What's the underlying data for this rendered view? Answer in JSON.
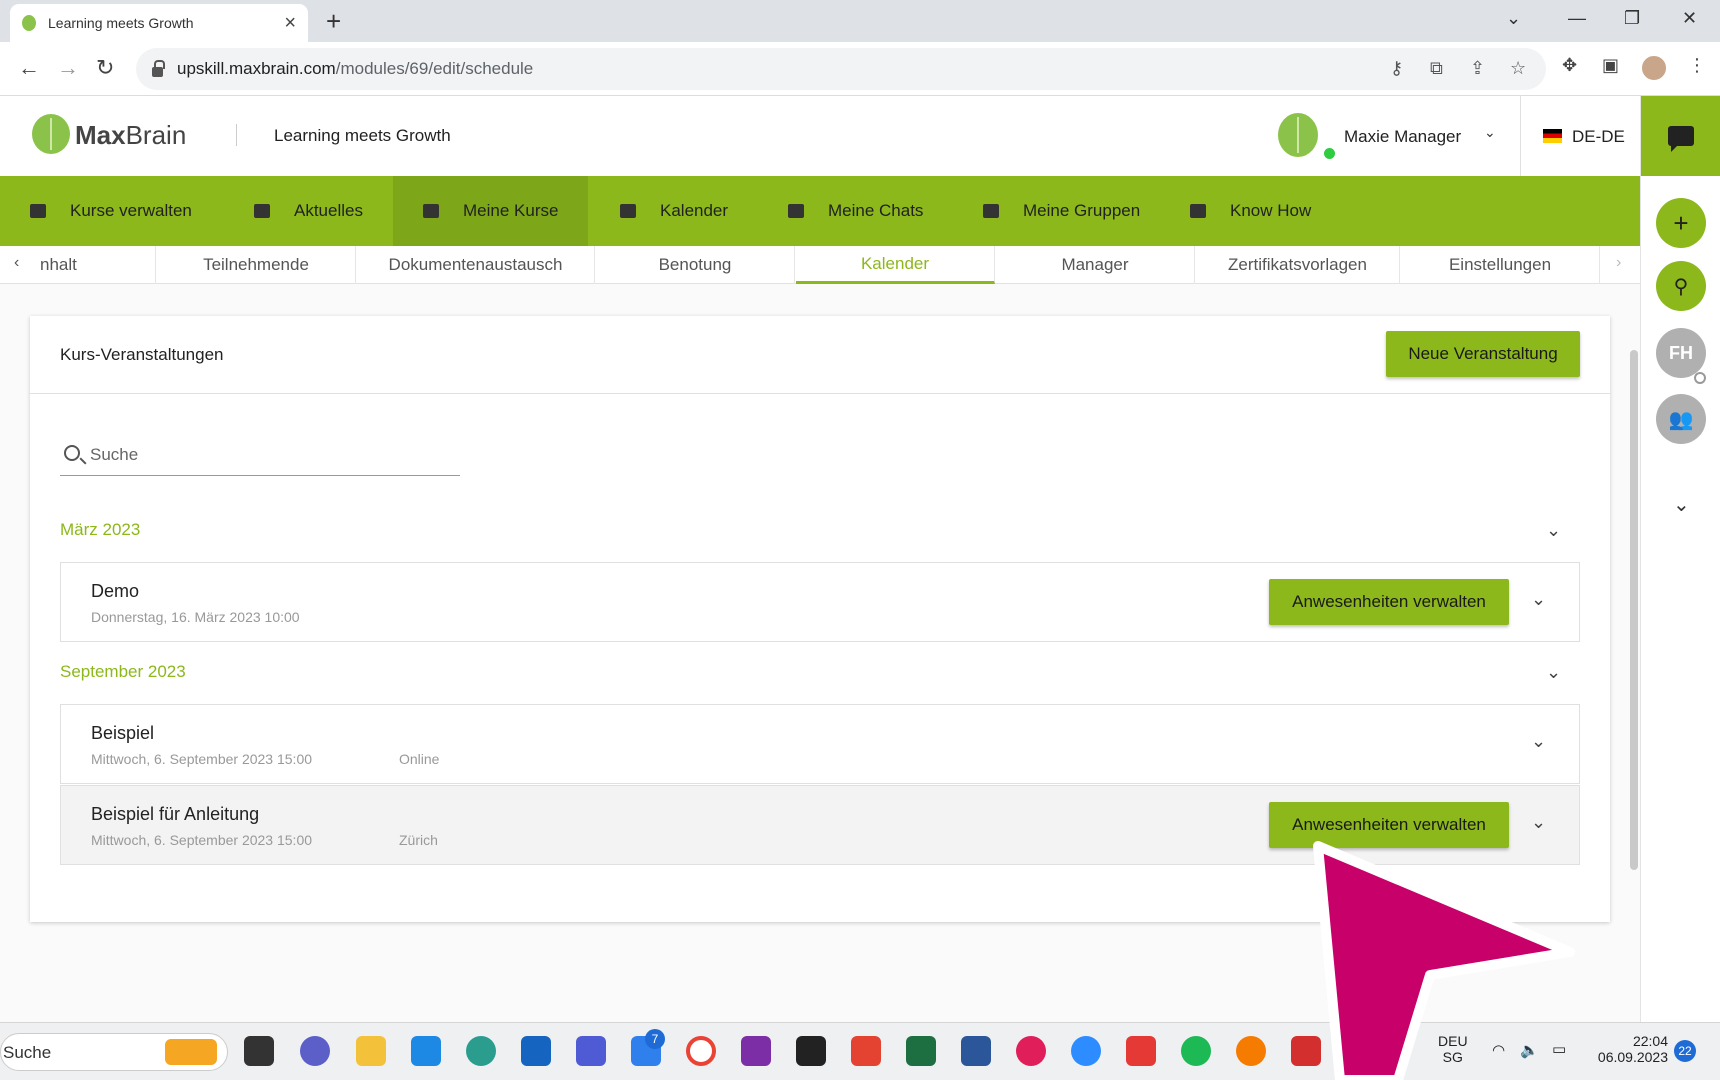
{
  "browser": {
    "tab_title": "Learning meets Growth",
    "url_host": "upskill.maxbrain.com",
    "url_path": "/modules/69/edit/schedule"
  },
  "header": {
    "logo_bold": "Max",
    "logo_light": "Brain",
    "site_title": "Learning meets Growth",
    "user_name": "Maxie Manager",
    "language": "DE-DE"
  },
  "rail": {
    "avatar_initials": "FH"
  },
  "mainnav": {
    "items": [
      {
        "label": "Kurse verwalten"
      },
      {
        "label": "Aktuelles"
      },
      {
        "label": "Meine Kurse"
      },
      {
        "label": "Kalender"
      },
      {
        "label": "Meine Chats"
      },
      {
        "label": "Meine Gruppen"
      },
      {
        "label": "Know How"
      }
    ]
  },
  "subtabs": {
    "items": [
      {
        "label": "nhalt"
      },
      {
        "label": "Teilnehmende"
      },
      {
        "label": "Dokumentenaustausch"
      },
      {
        "label": "Benotung"
      },
      {
        "label": "Kalender"
      },
      {
        "label": "Manager"
      },
      {
        "label": "Zertifikatsvorlagen"
      },
      {
        "label": "Einstellungen"
      }
    ]
  },
  "card": {
    "title": "Kurs-Veranstaltungen",
    "new_event_label": "Neue Veranstaltung",
    "search_placeholder": "Suche"
  },
  "groups": [
    {
      "month": "März 2023",
      "events": [
        {
          "title": "Demo",
          "date": "Donnerstag, 16. März 2023 10:00",
          "location": "",
          "action": "Anwesenheiten verwalten"
        }
      ]
    },
    {
      "month": "September 2023",
      "events": [
        {
          "title": "Beispiel",
          "date": "Mittwoch, 6. September 2023 15:00",
          "location": "Online",
          "action": ""
        },
        {
          "title": "Beispiel für Anleitung",
          "date": "Mittwoch, 6. September 2023 15:00",
          "location": "Zürich",
          "action": "Anwesenheiten verwalten"
        }
      ]
    }
  ],
  "taskbar": {
    "search_label": "Suche",
    "badge_count": "7",
    "lang_top": "DEU",
    "lang_bottom": "SG",
    "time": "22:04",
    "date": "06.09.2023",
    "notifications": "22"
  },
  "colors": {
    "accent": "#8cb81b",
    "accent_dark": "#7da718",
    "overlay_arrow": "#c8006a"
  }
}
